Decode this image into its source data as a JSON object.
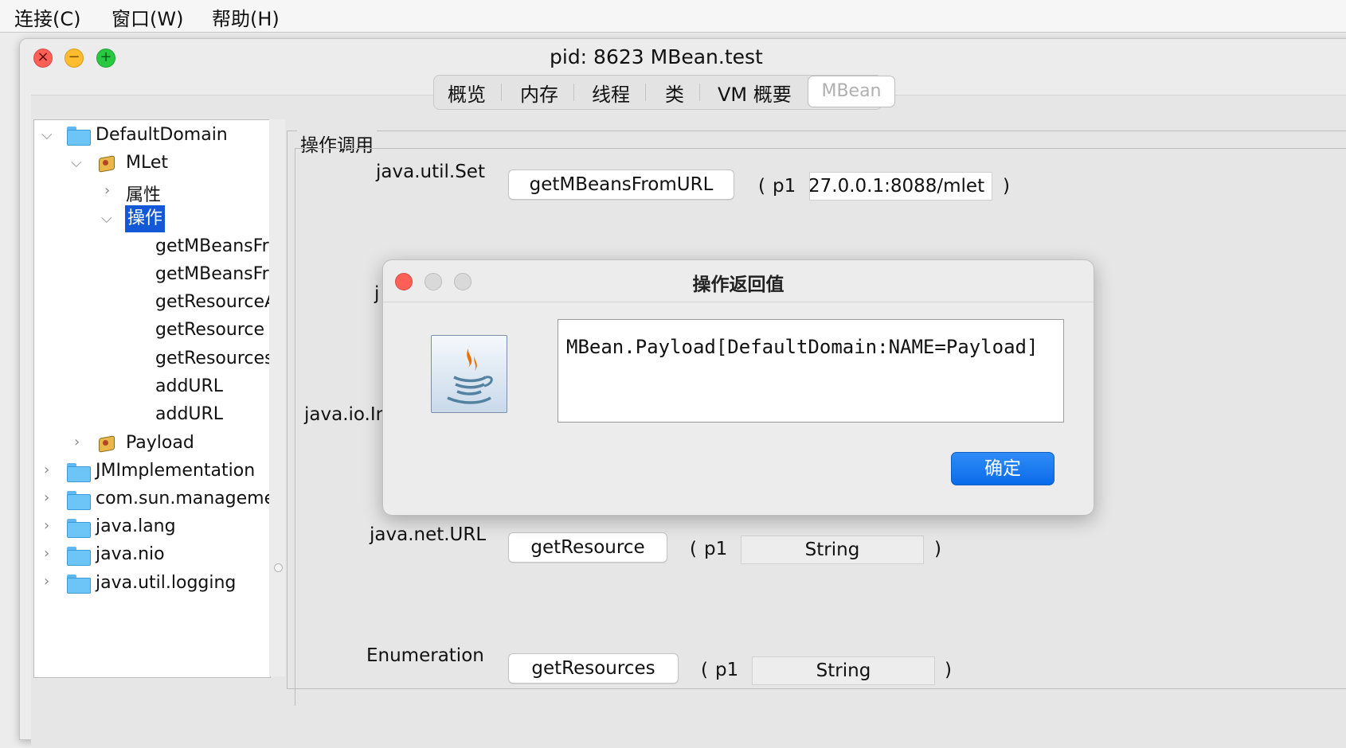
{
  "menubar": {
    "items": [
      "连接(C)",
      "窗口(W)",
      "帮助(H)"
    ]
  },
  "window": {
    "title": "pid: 8623 MBean.test"
  },
  "tabs": [
    "概览",
    "内存",
    "线程",
    "类",
    "VM 概要",
    "MBean"
  ],
  "tree": {
    "default_domain": "DefaultDomain",
    "mlet": "MLet",
    "attributes": "属性",
    "operations": "操作",
    "ops": [
      "getMBeansFro",
      "getMBeansFro",
      "getResourceA",
      "getResource",
      "getResources",
      "addURL",
      "addURL"
    ],
    "payload": "Payload",
    "domains": [
      "JMImplementation",
      "com.sun.manageme",
      "java.lang",
      "java.nio",
      "java.util.logging"
    ]
  },
  "operations_panel": {
    "legend": "操作调用",
    "rows": [
      {
        "return_type": "java.util.Set",
        "method": "getMBeansFromURL",
        "param_label": "p1",
        "param_value": "27.0.0.1:8088/mlet"
      },
      {
        "return_type": "j"
      },
      {
        "return_type": "java.io.In"
      },
      {
        "return_type": "java.net.URL",
        "method": "getResource",
        "param_label": "p1",
        "param_value": "String"
      },
      {
        "return_type": "Enumeration",
        "method": "getResources",
        "param_label": "p1",
        "param_value": "String"
      }
    ]
  },
  "dialog": {
    "title": "操作返回值",
    "result": "MBean.Payload[DefaultDomain:NAME=Payload]",
    "ok_label": "确定",
    "icon": "java-coffee-icon"
  },
  "colors": {
    "selection": "#1358d6",
    "ok_button": "#0a6bea",
    "close_red": "#fe5f57"
  }
}
